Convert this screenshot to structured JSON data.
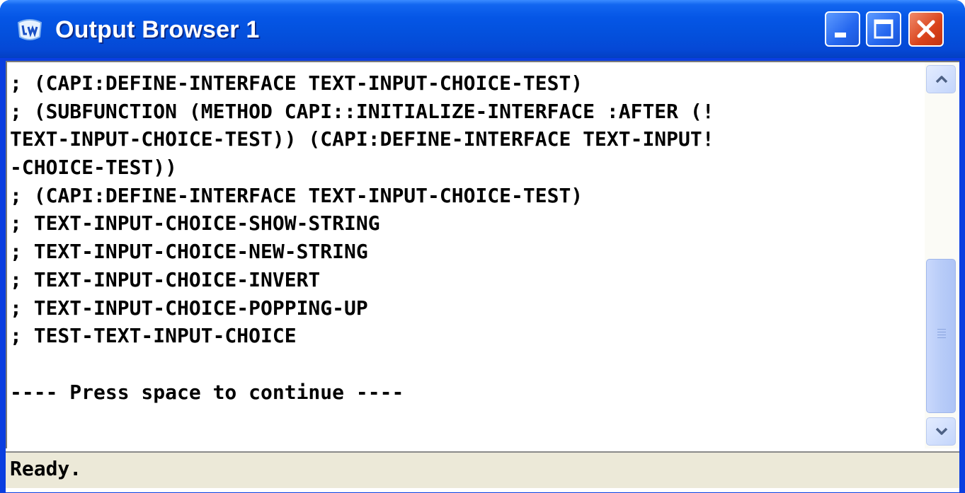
{
  "window": {
    "title": "Output Browser 1",
    "icon": "lispworks-app-icon",
    "controls": [
      "minimize-icon",
      "maximize-icon",
      "close-icon"
    ]
  },
  "output": {
    "lines": [
      "; (CAPI:DEFINE-INTERFACE TEXT-INPUT-CHOICE-TEST)",
      "; (SUBFUNCTION (METHOD CAPI::INITIALIZE-INTERFACE :AFTER (!",
      "TEXT-INPUT-CHOICE-TEST)) (CAPI:DEFINE-INTERFACE TEXT-INPUT!",
      "-CHOICE-TEST))",
      "; (CAPI:DEFINE-INTERFACE TEXT-INPUT-CHOICE-TEST)",
      "; TEXT-INPUT-CHOICE-SHOW-STRING",
      "; TEXT-INPUT-CHOICE-NEW-STRING",
      "; TEXT-INPUT-CHOICE-INVERT",
      "; TEXT-INPUT-CHOICE-POPPING-UP",
      "; TEST-TEXT-INPUT-CHOICE",
      "",
      "---- Press space to continue ----"
    ]
  },
  "scrollbar": {
    "up_icon": "chevron-up-icon",
    "down_icon": "chevron-down-icon",
    "thumb_icon": "grip-icon"
  },
  "status": {
    "text": "Ready."
  }
}
